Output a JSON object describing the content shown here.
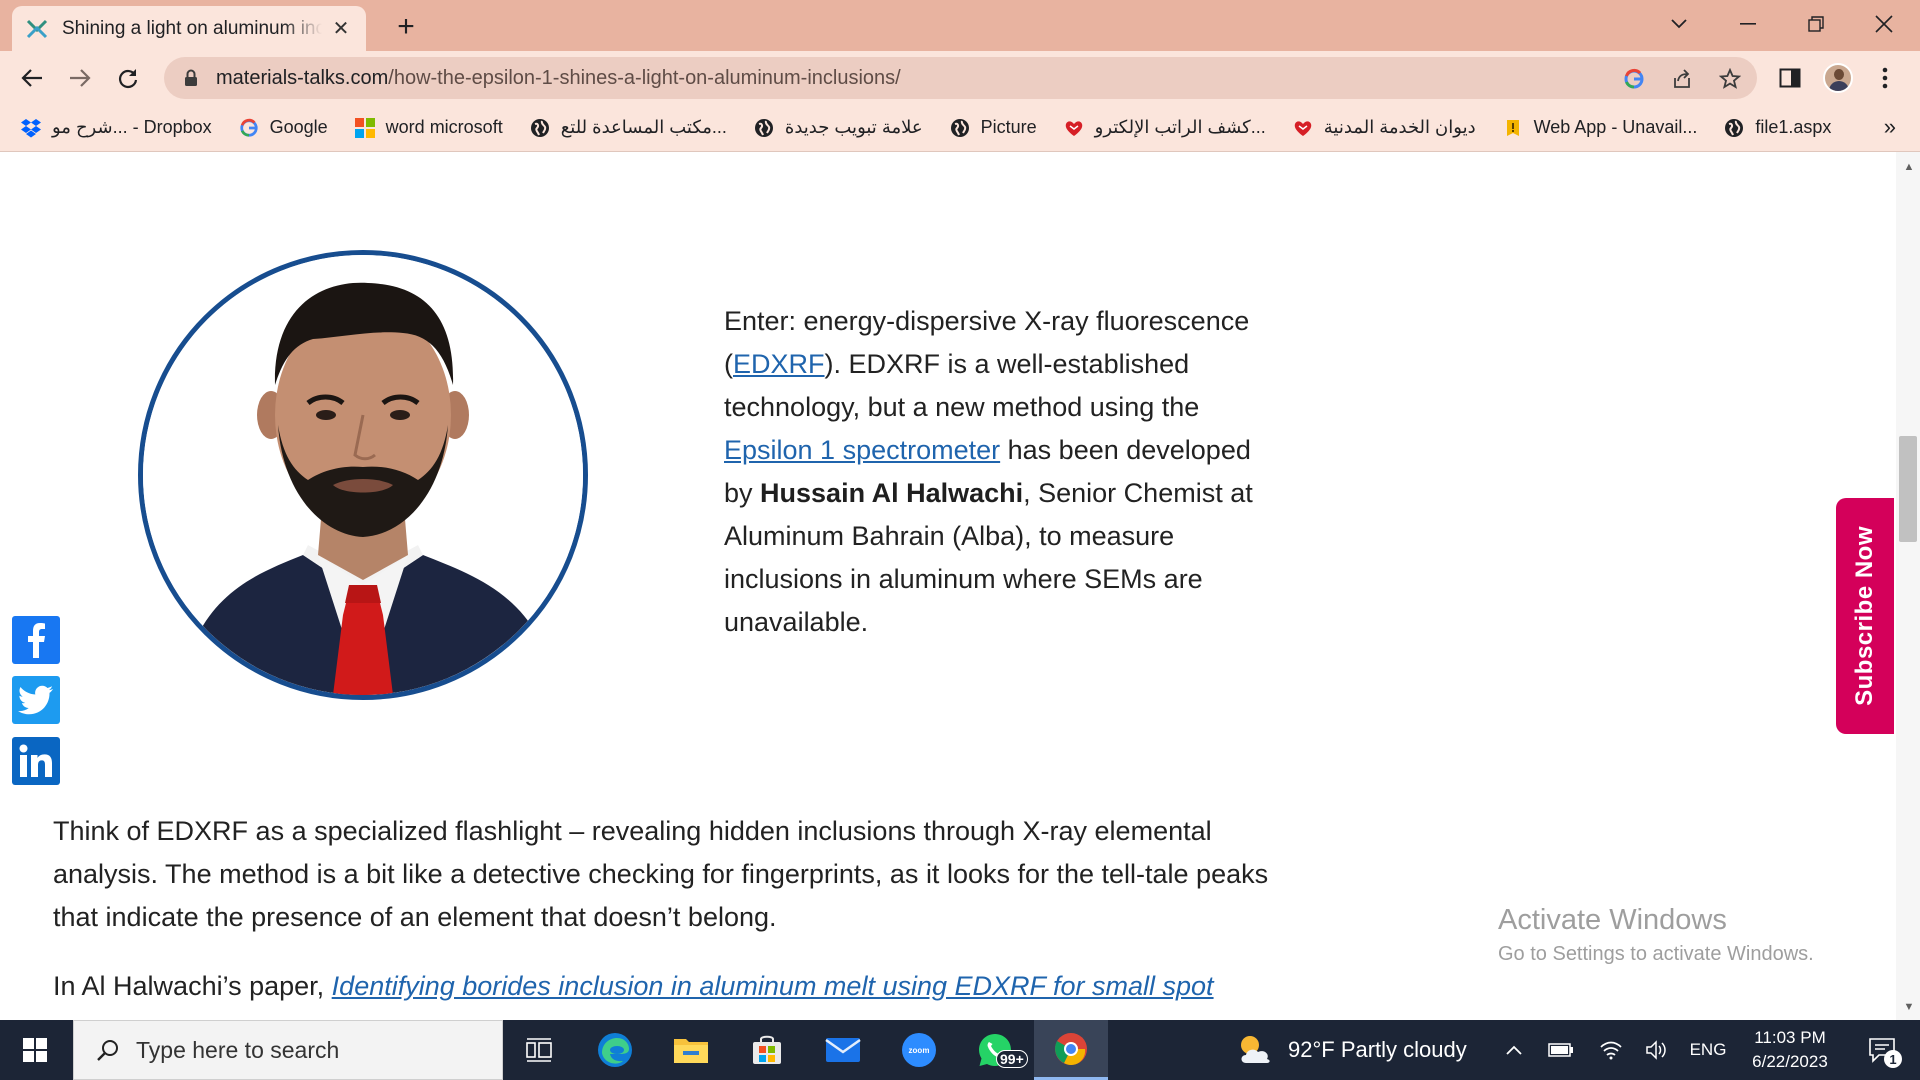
{
  "browser": {
    "tab": {
      "title": "Shining a light on aluminum inclusions"
    },
    "address": {
      "domain": "materials-talks.com",
      "path": "/how-the-epsilon-1-shines-a-light-on-aluminum-inclusions/"
    },
    "bookmarks": [
      {
        "label": "شرح مو... - Dropbox",
        "icon": "dropbox-icon"
      },
      {
        "label": "Google",
        "icon": "google-icon"
      },
      {
        "label": "word microsoft",
        "icon": "microsoft-icon"
      },
      {
        "label": "مكتب المساعدة للتع...",
        "icon": "globe-icon"
      },
      {
        "label": "علامة تبويب جديدة",
        "icon": "globe-icon"
      },
      {
        "label": "Picture",
        "icon": "globe-icon"
      },
      {
        "label": "كشف الراتب الإلكترو...",
        "icon": "heart-shield-icon"
      },
      {
        "label": "ديوان الخدمة المدنية",
        "icon": "heart-shield-icon"
      },
      {
        "label": "Web App - Unavail...",
        "icon": "warning-icon"
      },
      {
        "label": "file1.aspx",
        "icon": "globe-icon"
      }
    ]
  },
  "article": {
    "intro": {
      "p1": "Enter: energy-dispersive X-ray fluorescence (",
      "link1": "EDXRF",
      "p2": "). EDXRF is a well-established technology, but a new method using the ",
      "link2": "Epsilon 1 spectrometer",
      "p3": " has been developed by ",
      "name": "Hussain Al Halwachi",
      "p4": ", Senior Chemist at Aluminum Bahrain (Alba), to measure inclusions in aluminum where SEMs are unavailable."
    },
    "body1": "Think of EDXRF as a specialized flashlight – revealing hidden inclusions through X-ray elemental analysis. The method is a bit like a detective checking for fingerprints, as it looks for the tell-tale peaks that indicate the presence of an element that doesn’t belong.",
    "body2_prefix": "In Al Halwachi’s paper, ",
    "body2_link": "Identifying borides inclusion in aluminum melt using EDXRF for small spot"
  },
  "subscribe_label": "Subscribe Now",
  "activate_windows": {
    "title": "Activate Windows",
    "subtitle": "Go to Settings to activate Windows."
  },
  "taskbar": {
    "search_placeholder": "Type here to search",
    "whatsapp_badge": "99+",
    "weather": "92°F  Partly cloudy",
    "language": "ENG",
    "time": "11:03 PM",
    "date": "6/22/2023",
    "notification_count": "1"
  },
  "colors": {
    "tab_strip": "#e8b3a0",
    "toolbar": "#fbe5dc",
    "link": "#1f64ad",
    "subscribe": "#d4005a",
    "taskbar": "#1c2536"
  }
}
